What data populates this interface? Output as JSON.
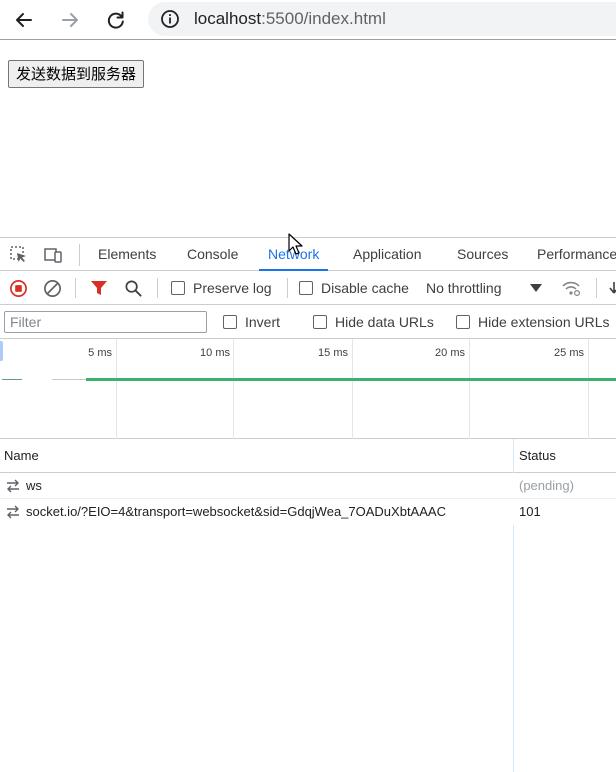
{
  "browser": {
    "url_host": "localhost",
    "url_rest": ":5500/index.html",
    "icons": [
      "back-arrow-icon",
      "forward-arrow-icon",
      "reload-icon",
      "info-icon"
    ]
  },
  "page": {
    "button_label": "发送数据到服务器"
  },
  "devtools": {
    "tabs": [
      {
        "label": "Elements"
      },
      {
        "label": "Console"
      },
      {
        "label": "Network"
      },
      {
        "label": "Application"
      },
      {
        "label": "Sources"
      },
      {
        "label": "Performance"
      }
    ],
    "active_tab": "Network",
    "toolbar": {
      "preserve_log": "Preserve log",
      "disable_cache": "Disable cache",
      "throttling": "No throttling"
    },
    "filter": {
      "placeholder": "Filter",
      "invert": "Invert",
      "hide_data_urls": "Hide data URLs",
      "hide_extension_urls": "Hide extension URLs"
    },
    "overview": {
      "ticks": [
        "5 ms",
        "10 ms",
        "15 ms",
        "20 ms",
        "25 ms"
      ]
    },
    "table": {
      "columns": [
        "Name",
        "Status"
      ],
      "rows": [
        {
          "name": "ws",
          "status": "(pending)"
        },
        {
          "name": "socket.io/?EIO=4&transport=websocket&sid=GdqjWea_7OADuXbtAAAC",
          "status": "101"
        }
      ]
    },
    "colors": {
      "accent": "#1a73e8",
      "record_red": "#d93025",
      "timeline_green": "#3bb16b"
    }
  }
}
